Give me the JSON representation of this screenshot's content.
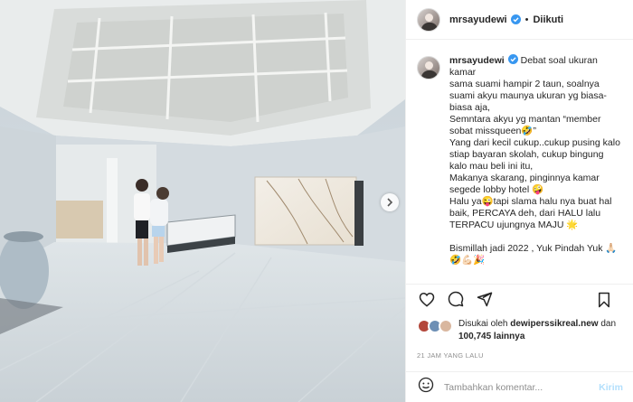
{
  "post": {
    "username": "mrsayudewi",
    "follow_status": "Diikuti",
    "separator": "•",
    "caption_user": "mrsayudewi",
    "caption_lines": [
      "Debat soal ukuran kamar",
      "sama suami hampir 2 taun, soalnya",
      "suami akyu maunya ukuran yg biasa-",
      "biasa aja,",
      "Semntara akyu yg mantan “member",
      "sobat missqueen🤣”",
      "Yang dari kecil cukup..cukup pusing kalo",
      "stiap bayaran skolah, cukup bingung",
      "kalo mau beli ini itu,",
      "Makanya skarang, pinginnya kamar",
      "segede lobby hotel 🤪",
      "Halu ya😜tapi slama halu nya buat hal",
      "baik, PERCAYA deh, dari HALU lalu",
      "TERPACU ujungnya MAJU 🌟",
      "",
      "Bismillah jadi 2022 , Yuk Pindah Yuk 🙏🏻",
      "🤣💪🏻🎉"
    ],
    "likes_prefix": "Disukai oleh",
    "liker": "dewiperssikreal.new",
    "likes_and": "dan",
    "likes_count": "100,745 lainnya",
    "timestamp": "21 JAM YANG LALU",
    "comment_placeholder": "Tambahkan komentar...",
    "post_button": "Kirim"
  },
  "icons": {
    "like": "heart-icon",
    "comment": "comment-icon",
    "share": "share-icon",
    "save": "bookmark-icon",
    "emoji": "smiley-icon",
    "next": "chevron-right-icon",
    "verified": "verified-badge-icon"
  },
  "colors": {
    "verified": "#3897f0",
    "post_button_disabled": "#b2dffc",
    "secondary_text": "#8e8e8e",
    "border": "#efefef"
  }
}
